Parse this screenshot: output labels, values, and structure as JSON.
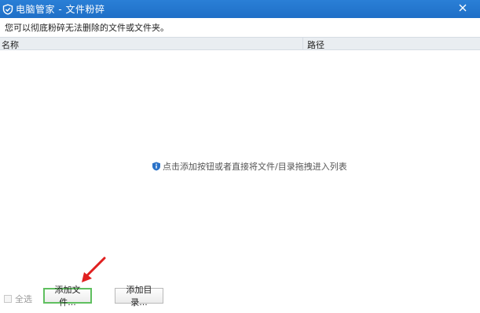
{
  "window": {
    "title": "电脑管家 - 文件粉碎"
  },
  "description": "您可以彻底粉碎无法删除的文件或文件夹。",
  "list": {
    "columns": [
      "名称",
      "路径"
    ],
    "empty_hint": "点击添加按钮或者直接将文件/目录拖拽进入列表"
  },
  "footer": {
    "select_all_label": "全选",
    "select_all_checked": false,
    "add_file_label": "添加文件...",
    "add_dir_label": "添加目录..."
  },
  "colors": {
    "titlebar": "#1f6fc7",
    "header_bg": "#e9edf1",
    "add_file_border": "#5fbf5f",
    "arrow": "#e02020",
    "info_icon": "#2a72c8"
  },
  "icons": {
    "title_logo": "shield-logo-icon",
    "close": "close-icon",
    "hint": "info-shield-icon",
    "annotation": "red-arrow-icon"
  }
}
